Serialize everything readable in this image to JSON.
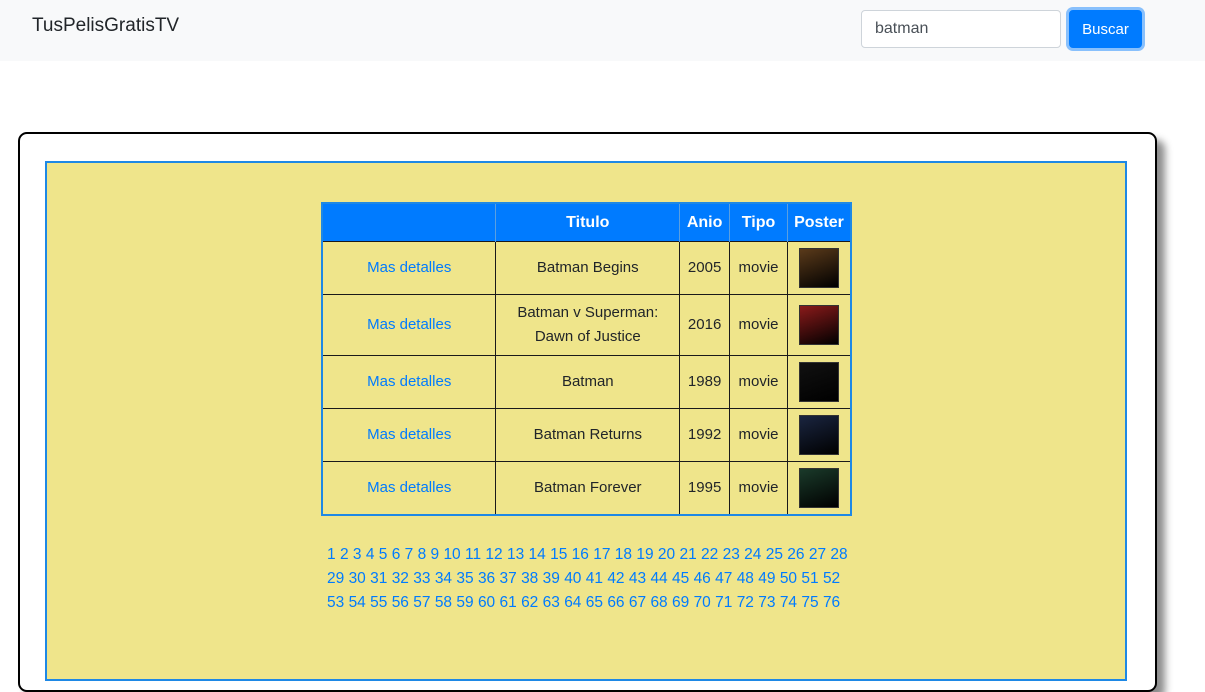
{
  "navbar": {
    "brand": "TusPelisGratisTV",
    "search_value": "batman",
    "search_button": "Buscar"
  },
  "table": {
    "headers": [
      "",
      "Titulo",
      "Anio",
      "Tipo",
      "Poster"
    ],
    "rows": [
      {
        "link": "Mas detalles",
        "title": "Batman Begins",
        "year": "2005",
        "type": "movie",
        "poster_color": "#5a3a1a"
      },
      {
        "link": "Mas detalles",
        "title": "Batman v Superman: Dawn of Justice",
        "year": "2016",
        "type": "movie",
        "poster_color": "#8a1a1a"
      },
      {
        "link": "Mas detalles",
        "title": "Batman",
        "year": "1989",
        "type": "movie",
        "poster_color": "#111111"
      },
      {
        "link": "Mas detalles",
        "title": "Batman Returns",
        "year": "1992",
        "type": "movie",
        "poster_color": "#1a2540"
      },
      {
        "link": "Mas detalles",
        "title": "Batman Forever",
        "year": "1995",
        "type": "movie",
        "poster_color": "#1a3a2a"
      }
    ]
  },
  "pagination": {
    "pages": [
      "1",
      "2",
      "3",
      "4",
      "5",
      "6",
      "7",
      "8",
      "9",
      "10",
      "11",
      "12",
      "13",
      "14",
      "15",
      "16",
      "17",
      "18",
      "19",
      "20",
      "21",
      "22",
      "23",
      "24",
      "25",
      "26",
      "27",
      "28",
      "29",
      "30",
      "31",
      "32",
      "33",
      "34",
      "35",
      "36",
      "37",
      "38",
      "39",
      "40",
      "41",
      "42",
      "43",
      "44",
      "45",
      "46",
      "47",
      "48",
      "49",
      "50",
      "51",
      "52",
      "53",
      "54",
      "55",
      "56",
      "57",
      "58",
      "59",
      "60",
      "61",
      "62",
      "63",
      "64",
      "65",
      "66",
      "67",
      "68",
      "69",
      "70",
      "71",
      "72",
      "73",
      "74",
      "75",
      "76"
    ]
  }
}
